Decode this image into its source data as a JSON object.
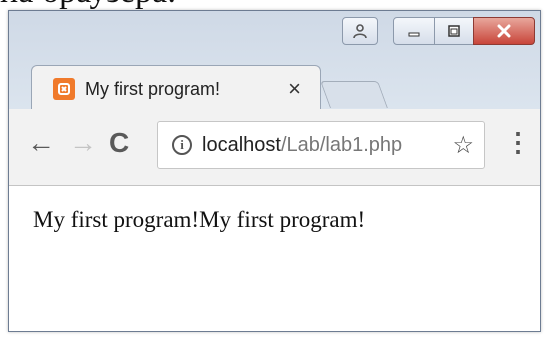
{
  "caption_fragment": "на браузера:",
  "window": {
    "tab": {
      "title": "My first program!",
      "close_glyph": "×"
    },
    "toolbar": {
      "url_host": "localhost",
      "url_path": "/Lab/lab1.php"
    },
    "content": {
      "text": "My first program!My first program!"
    }
  },
  "icons": {
    "user": "user-icon",
    "minimize": "minimize-icon",
    "maximize": "maximize-icon",
    "close": "close-icon",
    "favicon": "xampp-favicon-icon",
    "back": "back-arrow-icon",
    "forward": "forward-arrow-icon",
    "reload": "reload-icon",
    "info": "info-icon",
    "star": "star-icon",
    "menu": "kebab-menu-icon"
  },
  "colors": {
    "close_button": "#c8453a",
    "favicon": "#f07a2b"
  }
}
